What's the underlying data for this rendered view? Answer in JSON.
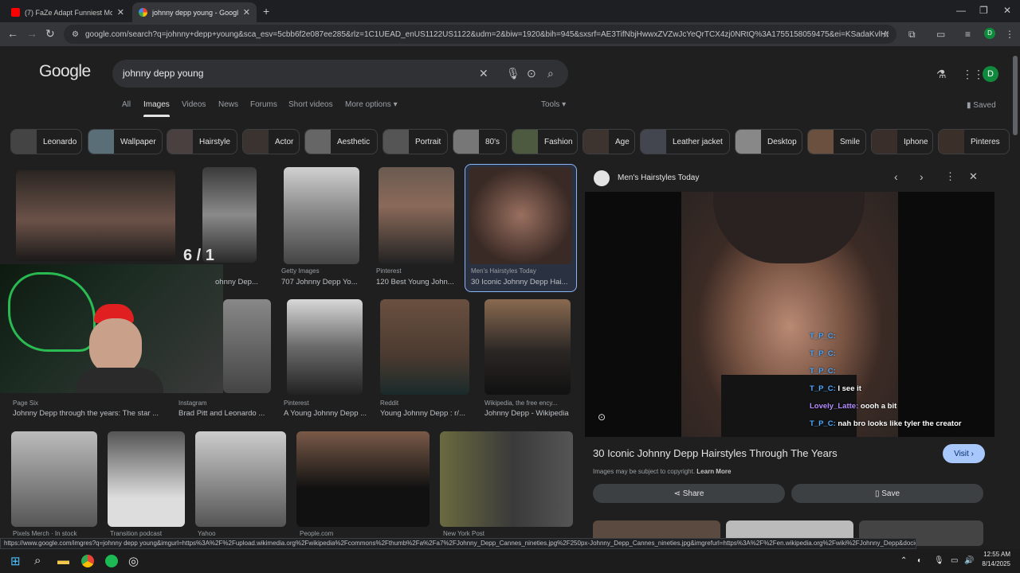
{
  "browser": {
    "tabs": [
      {
        "title": "(7) FaZe Adapt Funniest Mome",
        "active": false,
        "favicon_color": "#ff0000"
      },
      {
        "title": "johnny depp young - Google S",
        "active": true,
        "favicon_color": "#4285f4"
      }
    ],
    "new_tab": "+",
    "url": "google.com/search?q=johnny+depp+young&sca_esv=5cbb6f2e087ee285&rlz=1C1UEAD_enUS1122US1122&udm=2&biw=1920&bih=945&sxsrf=AE3TifNbjHwwxZVZwJcYeQrTCX4zj0NRtQ%3A1755158059475&ei=KSadaKvlHOSkqtsP36KW...",
    "profile_initial": "D"
  },
  "google": {
    "logo": "Google",
    "query": "johnny depp young",
    "tabs": [
      "All",
      "Images",
      "Videos",
      "News",
      "Forums",
      "Short videos",
      "More options"
    ],
    "active_tab": "Images",
    "tools": "Tools",
    "saved": "Saved",
    "avatar": "D"
  },
  "chips": [
    "Leonardo",
    "Wallpaper",
    "Hairstyle",
    "Actor",
    "Aesthetic",
    "Portrait",
    "80's",
    "Fashion",
    "Age",
    "Leather jacket",
    "Desktop",
    "Smile",
    "Iphone",
    "Pinteres"
  ],
  "results": [
    {
      "source": "Getty Images",
      "title": "707 Johnny Depp Yo..."
    },
    {
      "source": "Pinterest",
      "title": "120 Best Young John..."
    },
    {
      "source": "Men's Hairstyles Today",
      "title": "30 Iconic Johnny Depp Hai..."
    },
    {
      "source": "",
      "title": "ohnny Dep..."
    },
    {
      "source": "Page Six",
      "title": "Johnny Depp through the years: The star ..."
    },
    {
      "source": "Instagram",
      "title": "Brad Pitt and Leonardo ..."
    },
    {
      "source": "Pinterest",
      "title": "A Young Johnny Depp ..."
    },
    {
      "source": "Reddit",
      "title": "Young Johnny Depp : r/..."
    },
    {
      "source": "Wikipedia, the free ency...",
      "title": "Johnny Depp - Wikipedia"
    },
    {
      "source": "Pixels Merch · In stock",
      "title": ""
    },
    {
      "source": "Transition podcast",
      "title": ""
    },
    {
      "source": "Yahoo",
      "title": ""
    },
    {
      "source": "People.com",
      "title": ""
    },
    {
      "source": "New York Post",
      "title": ""
    }
  ],
  "overlay_counter": "6 / 1",
  "preview": {
    "source": "Men's Hairstyles Today",
    "title": "30 Iconic Johnny Depp Hairstyles Through The Years",
    "visit": "Visit",
    "copyright": "Images may be subject to copyright.",
    "learn_more": "Learn More",
    "share": "Share",
    "save": "Save"
  },
  "chat": [
    {
      "user": "T_P_C:",
      "msg": ""
    },
    {
      "user": "T_P_C:",
      "msg": ""
    },
    {
      "user": "T_P_C:",
      "msg": ""
    },
    {
      "user": "T_P_C:",
      "msg": "I see it"
    },
    {
      "user": "Lovely_Latte:",
      "msg": "oooh a bit"
    },
    {
      "user": "T_P_C:",
      "msg": "nah bro looks like tyler the creator"
    }
  ],
  "statusbar": "https://www.google.com/imgres?q=johnny depp young&imgurl=https%3A%2F%2Fupload.wikimedia.org%2Fwikipedia%2Fcommons%2Fthumb%2Fa%2Fa7%2FJohnny_Depp_Cannes_nineties.jpg%2F250px-Johnny_Depp_Cannes_nineties.jpg&imgrefurl=https%3A%2F%2Fen.wikipedia.org%2Fwiki%2FJohnny_Depp&docid=nQTZY-eoJNyGEM&tbnid=zizZ8...",
  "taskbar": {
    "time": "12:55 AM",
    "date": "8/14/2025"
  }
}
